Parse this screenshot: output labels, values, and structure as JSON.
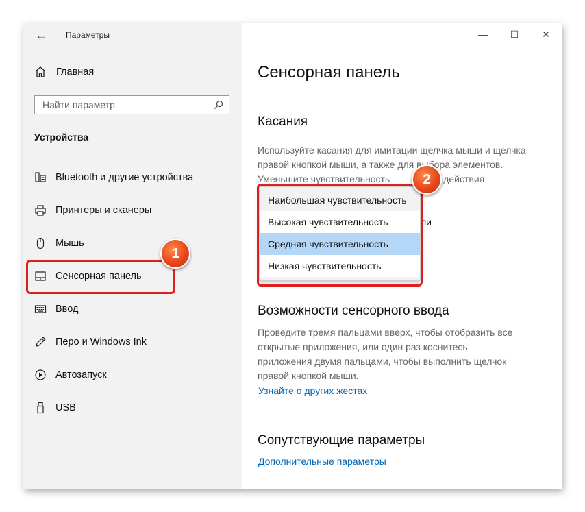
{
  "window": {
    "title": "Параметры",
    "back_icon": "back-arrow-icon",
    "controls": {
      "minimize": "—",
      "maximize": "☐",
      "close": "✕"
    }
  },
  "sidebar": {
    "home_label": "Главная",
    "search_placeholder": "Найти параметр",
    "section_title": "Устройства",
    "items": [
      {
        "label": "Bluetooth и другие устройства",
        "icon": "bluetooth-devices-icon"
      },
      {
        "label": "Принтеры и сканеры",
        "icon": "printer-icon"
      },
      {
        "label": "Мышь",
        "icon": "mouse-icon"
      },
      {
        "label": "Сенсорная панель",
        "icon": "touchpad-icon",
        "active": true
      },
      {
        "label": "Ввод",
        "icon": "keyboard-icon"
      },
      {
        "label": "Перо и Windows Ink",
        "icon": "pen-icon"
      },
      {
        "label": "Автозапуск",
        "icon": "autoplay-icon"
      },
      {
        "label": "USB",
        "icon": "usb-icon"
      }
    ]
  },
  "main": {
    "title": "Сенсорная панель",
    "taps": {
      "heading": "Касания",
      "desc_l1": "Используйте касания для имитации щелчка мыши и щелчка",
      "desc_l2": "правой кнопкой мыши, а также для выбора элементов.",
      "desc_l3_start": "Уменьшите чувствительность",
      "desc_l3_end": "действия",
      "partial_label": "ли"
    },
    "sensitivity_dropdown": {
      "options": [
        "Наибольшая чувствительность",
        "Высокая чувствительность",
        "Средняя чувствительность",
        "Низкая чувствительность"
      ],
      "selected": "Средняя чувствительность"
    },
    "touch_input": {
      "heading": "Возможности сенсорного ввода",
      "desc_l1": "Проведите тремя пальцами вверх, чтобы отобразить все",
      "desc_l2": "открытые приложения, или один раз коснитесь",
      "desc_l3": "приложения двумя пальцами, чтобы выполнить щелчок",
      "desc_l4": "правой кнопкой мыши.",
      "link": "Узнайте о других жестах"
    },
    "related": {
      "heading": "Сопутствующие параметры",
      "link": "Дополнительные параметры"
    }
  },
  "annotations": {
    "badge1": "1",
    "badge2": "2",
    "color": "#e02020"
  }
}
